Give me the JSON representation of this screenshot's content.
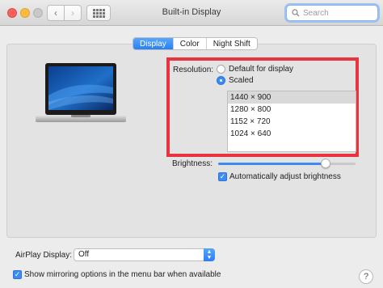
{
  "window": {
    "title": "Built-in Display"
  },
  "search": {
    "placeholder": "Search"
  },
  "tabs": [
    {
      "label": "Display",
      "active": true
    },
    {
      "label": "Color",
      "active": false
    },
    {
      "label": "Night Shift",
      "active": false
    }
  ],
  "resolution": {
    "label": "Resolution:",
    "options": [
      {
        "label": "Default for display",
        "checked": false
      },
      {
        "label": "Scaled",
        "checked": true
      }
    ],
    "list": [
      "1440 × 900",
      "1280 × 800",
      "1152 × 720",
      "1024 × 640"
    ],
    "selected_index": 0
  },
  "brightness": {
    "label": "Brightness:",
    "level": 0.78,
    "auto_label": "Automatically adjust brightness",
    "auto_checked": true
  },
  "airplay": {
    "label": "AirPlay Display:",
    "value": "Off"
  },
  "mirroring": {
    "label": "Show mirroring options in the menu bar when available",
    "checked": true
  },
  "help": {
    "label": "?"
  },
  "colors": {
    "accent": "#3b8bf6",
    "highlight": "#e8343e"
  }
}
